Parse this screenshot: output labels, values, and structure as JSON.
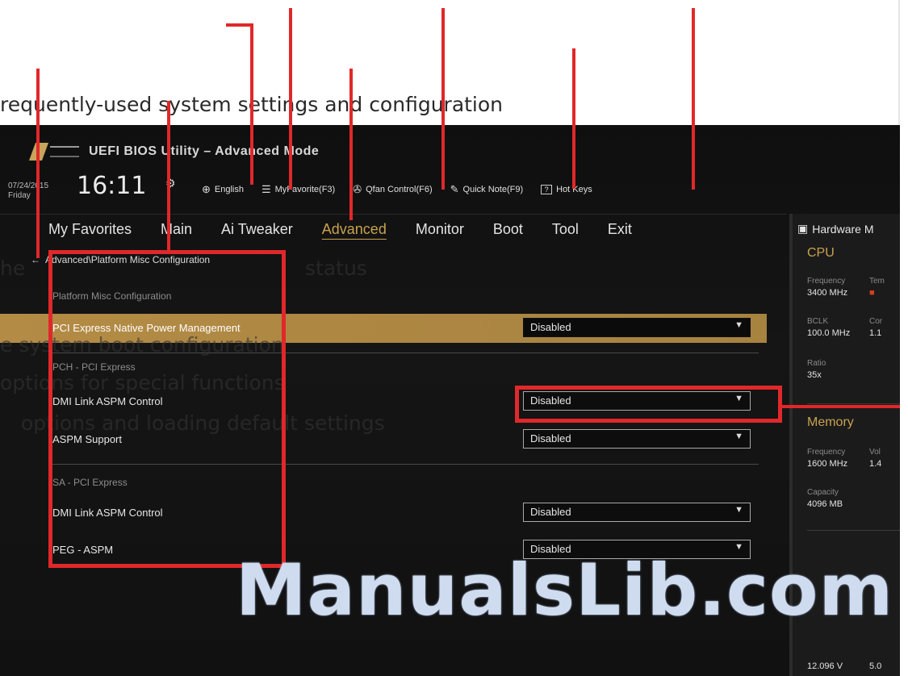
{
  "app": {
    "title": "UEFI BIOS Utility – Advanced Mode"
  },
  "status": {
    "date": "07/24/2015",
    "day": "Friday",
    "time": "16:11"
  },
  "toolbar": {
    "language": "English",
    "favorite": "MyFavorite(F3)",
    "qfan": "Qfan Control(F6)",
    "quicknote": "Quick Note(F9)",
    "hotkeys": "Hot Keys"
  },
  "tabs": [
    "My Favorites",
    "Main",
    "Ai Tweaker",
    "Advanced",
    "Monitor",
    "Boot",
    "Tool",
    "Exit"
  ],
  "active_tab": "Advanced",
  "breadcrumb": "Advanced\\Platform Misc Configuration",
  "page": {
    "header": "Platform Misc Configuration",
    "settings": [
      {
        "label": "PCI Express Native Power Management",
        "value": "Disabled"
      },
      {
        "label": "DMI Link ASPM Control",
        "value": "Disabled"
      },
      {
        "label": "ASPM Support",
        "value": "Disabled"
      },
      {
        "label": "DMI Link ASPM Control",
        "value": "Disabled"
      },
      {
        "label": "PEG - ASPM",
        "value": "Disabled"
      }
    ],
    "sections": [
      "PCH - PCI Express",
      "SA - PCI Express"
    ]
  },
  "hw": {
    "title": "Hardware M",
    "cpu": {
      "label": "CPU",
      "freq_k": "Frequency",
      "freq_v": "3400 MHz",
      "temp_k": "Tem",
      "bclk_k": "BCLK",
      "bclk_v": "100.0 MHz",
      "core_k": "Cor",
      "core_v": "1.1",
      "ratio_k": "Ratio",
      "ratio_v": "35x"
    },
    "memory": {
      "label": "Memory",
      "freq_k": "Frequency",
      "freq_v": "1600 MHz",
      "volt_k": "Vol",
      "volt_v": "1.4",
      "cap_k": "Capacity",
      "cap_v": "4096 MB"
    },
    "voltage": {
      "v1": "12.096 V",
      "v2": "5.0"
    }
  },
  "overlay": {
    "line1": "requently-used system settings and configuration",
    "line4": "he",
    "line5": "status",
    "line6": "e system boot configuration",
    "line7": "options for special functions",
    "line8": "options and loading default settings"
  },
  "watermark": "ManualsLib.com",
  "colors": {
    "annotation": "#e0282a",
    "accent": "#c9a24e",
    "highlight_row": "#b38b45"
  }
}
